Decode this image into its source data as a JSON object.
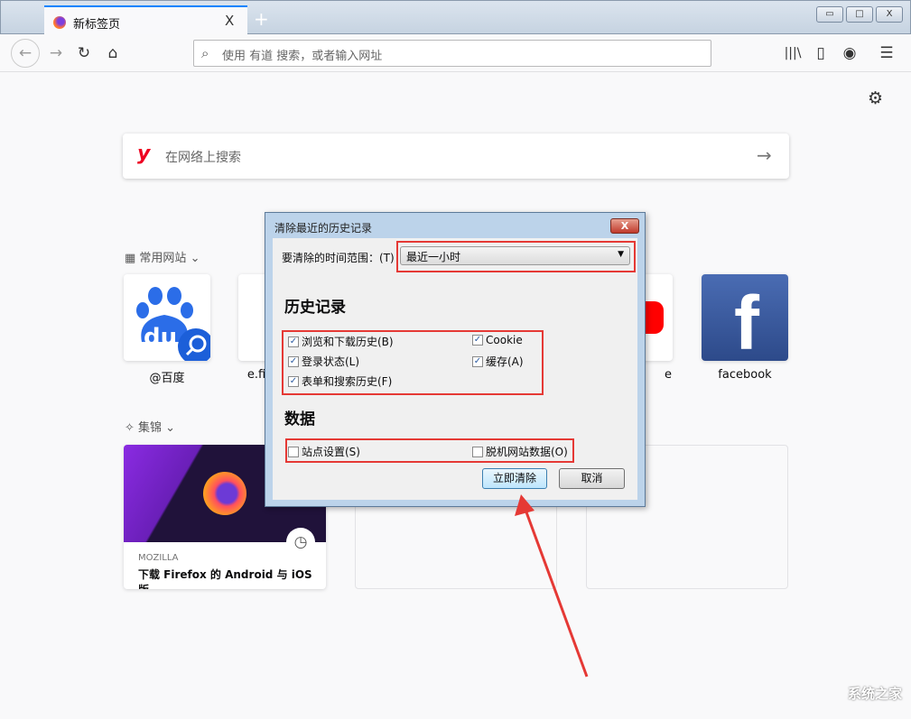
{
  "browser": {
    "tab_title": "新标签页",
    "tab_close": "X",
    "new_tab": "+",
    "window_buttons": [
      "▭",
      "□",
      "X"
    ],
    "url_placeholder": "使用 有道 搜索，或者输入网址"
  },
  "newtab": {
    "search_placeholder": "在网络上搜索",
    "top_sites_label": "常用网站",
    "highlights_label": "集锦",
    "top_sites": [
      {
        "label": "@百度"
      },
      {
        "label": "e.fi"
      },
      {
        "label": "e"
      },
      {
        "label": "facebook"
      }
    ],
    "card": {
      "source": "MOZILLA",
      "title": "下载 Firefox 的 Android 与 iOS 版"
    }
  },
  "dialog": {
    "title": "清除最近的历史记录",
    "range_label": "要清除的时间范围：(T)",
    "range_value": "最近一小时",
    "history_heading": "历史记录",
    "data_heading": "数据",
    "history_items": [
      {
        "label": "浏览和下载历史(B)",
        "checked": true
      },
      {
        "label": "Cookie",
        "checked": true
      },
      {
        "label": "登录状态(L)",
        "checked": true
      },
      {
        "label": "缓存(A)",
        "checked": true
      },
      {
        "label": "表单和搜索历史(F)",
        "checked": true
      }
    ],
    "data_items": [
      {
        "label": "站点设置(S)",
        "checked": false
      },
      {
        "label": "脱机网站数据(O)",
        "checked": false
      }
    ],
    "clear_button": "立即清除",
    "cancel_button": "取消"
  },
  "annotation_color": "#e53935",
  "watermark": "系统之家"
}
